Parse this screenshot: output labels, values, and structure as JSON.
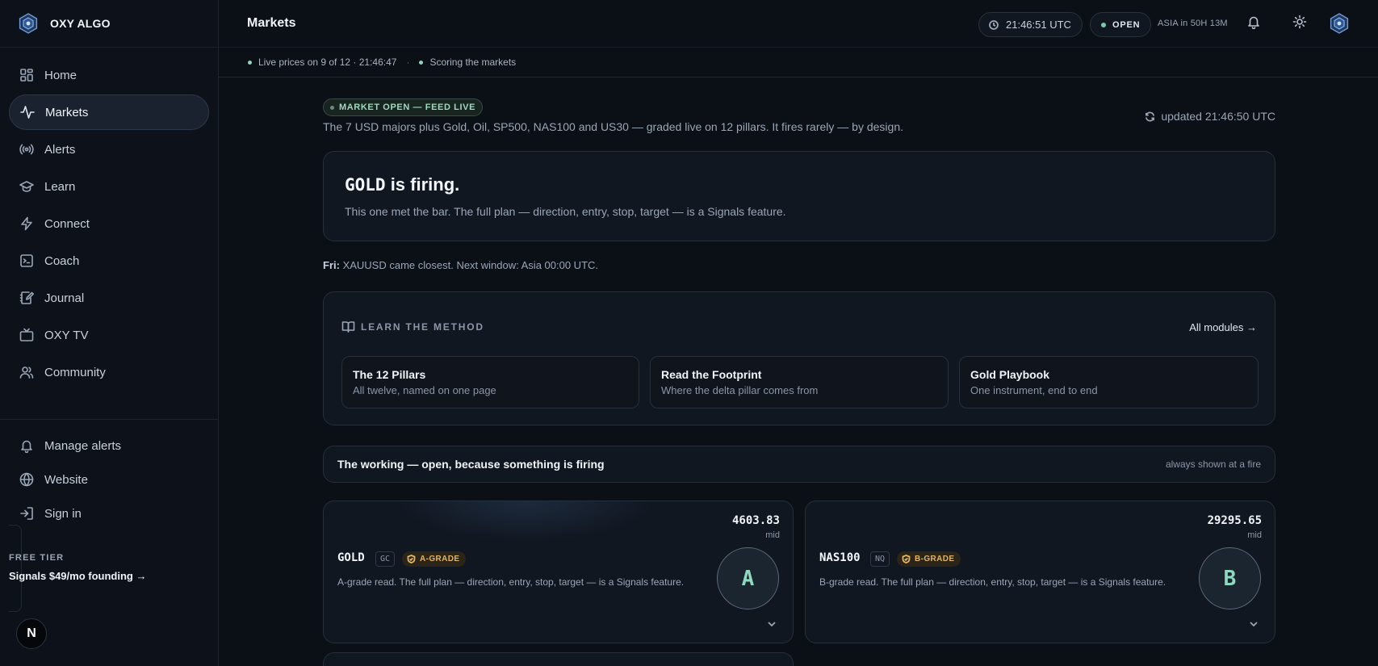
{
  "app": {
    "brand": "OXY ALGO"
  },
  "sidebar": {
    "items": [
      {
        "label": "Home",
        "icon": "home-grid-icon"
      },
      {
        "label": "Markets",
        "icon": "activity-icon",
        "active": true
      },
      {
        "label": "Alerts",
        "icon": "radio-broadcast-icon"
      },
      {
        "label": "Learn",
        "icon": "graduation-cap-icon"
      },
      {
        "label": "Connect",
        "icon": "lightning-icon"
      },
      {
        "label": "Coach",
        "icon": "terminal-icon"
      },
      {
        "label": "Journal",
        "icon": "notebook-pen-icon"
      },
      {
        "label": "OXY TV",
        "icon": "tv-icon"
      },
      {
        "label": "Community",
        "icon": "users-icon"
      }
    ],
    "bottom": [
      {
        "label": "Manage alerts",
        "icon": "bell-icon"
      },
      {
        "label": "Website",
        "icon": "globe-icon"
      },
      {
        "label": "Sign in",
        "icon": "sign-in-icon"
      }
    ],
    "tier": {
      "label": "FREE TIER",
      "cta": "Signals $49/mo founding →"
    },
    "badge": "N"
  },
  "header": {
    "title": "Markets",
    "clock": "21:46:51 UTC",
    "market_status": "OPEN",
    "next_session": "ASIA in 50H 13M"
  },
  "subbar": {
    "live": "Live prices on 9 of 12 · 21:46:47",
    "sep": "·",
    "scoring": "Scoring the markets"
  },
  "main": {
    "status_chip": "MARKET OPEN — FEED LIVE",
    "intro": "The 7 USD majors plus Gold, Oil, SP500, NAS100 and US30 — graded live on 12 pillars. It fires rarely — by design.",
    "updated": "updated 21:46:50 UTC",
    "firing": {
      "symbol": "GOLD",
      "title_rest": " is firing.",
      "text": "This one met the bar. The full plan — direction, entry, stop, target — is a Signals feature."
    },
    "closest": {
      "prefix": "Fri:",
      "text": " XAUUSD came closest. Next window: Asia 00:00 UTC."
    },
    "learn": {
      "heading": "LEARN THE METHOD",
      "all_link": "All modules →",
      "modules": [
        {
          "title": "The 12 Pillars",
          "sub": "All twelve, named on one page"
        },
        {
          "title": "Read the Footprint",
          "sub": "Where the delta pillar comes from"
        },
        {
          "title": "Gold Playbook",
          "sub": "One instrument, end to end"
        }
      ]
    },
    "working": {
      "title": "The working — open, because something is firing",
      "note": "always shown at a fire"
    },
    "assets": [
      {
        "symbol": "GOLD",
        "ticker": "GC",
        "grade": "A-GRADE",
        "desc": "A-grade read. The full plan — direction, entry, stop, target — is a Signals feature.",
        "price": "4603.83",
        "price_label": "mid",
        "letter": "A"
      },
      {
        "symbol": "NAS100",
        "ticker": "NQ",
        "grade": "B-GRADE",
        "desc": "B-grade read. The full plan — direction, entry, stop, target — is a Signals feature.",
        "price": "29295.65",
        "price_label": "mid",
        "letter": "B"
      }
    ]
  },
  "colors": {
    "accent_live": "#7fc8b0",
    "grade_gold": "#e2b46a",
    "bg": "#0b0f16"
  }
}
